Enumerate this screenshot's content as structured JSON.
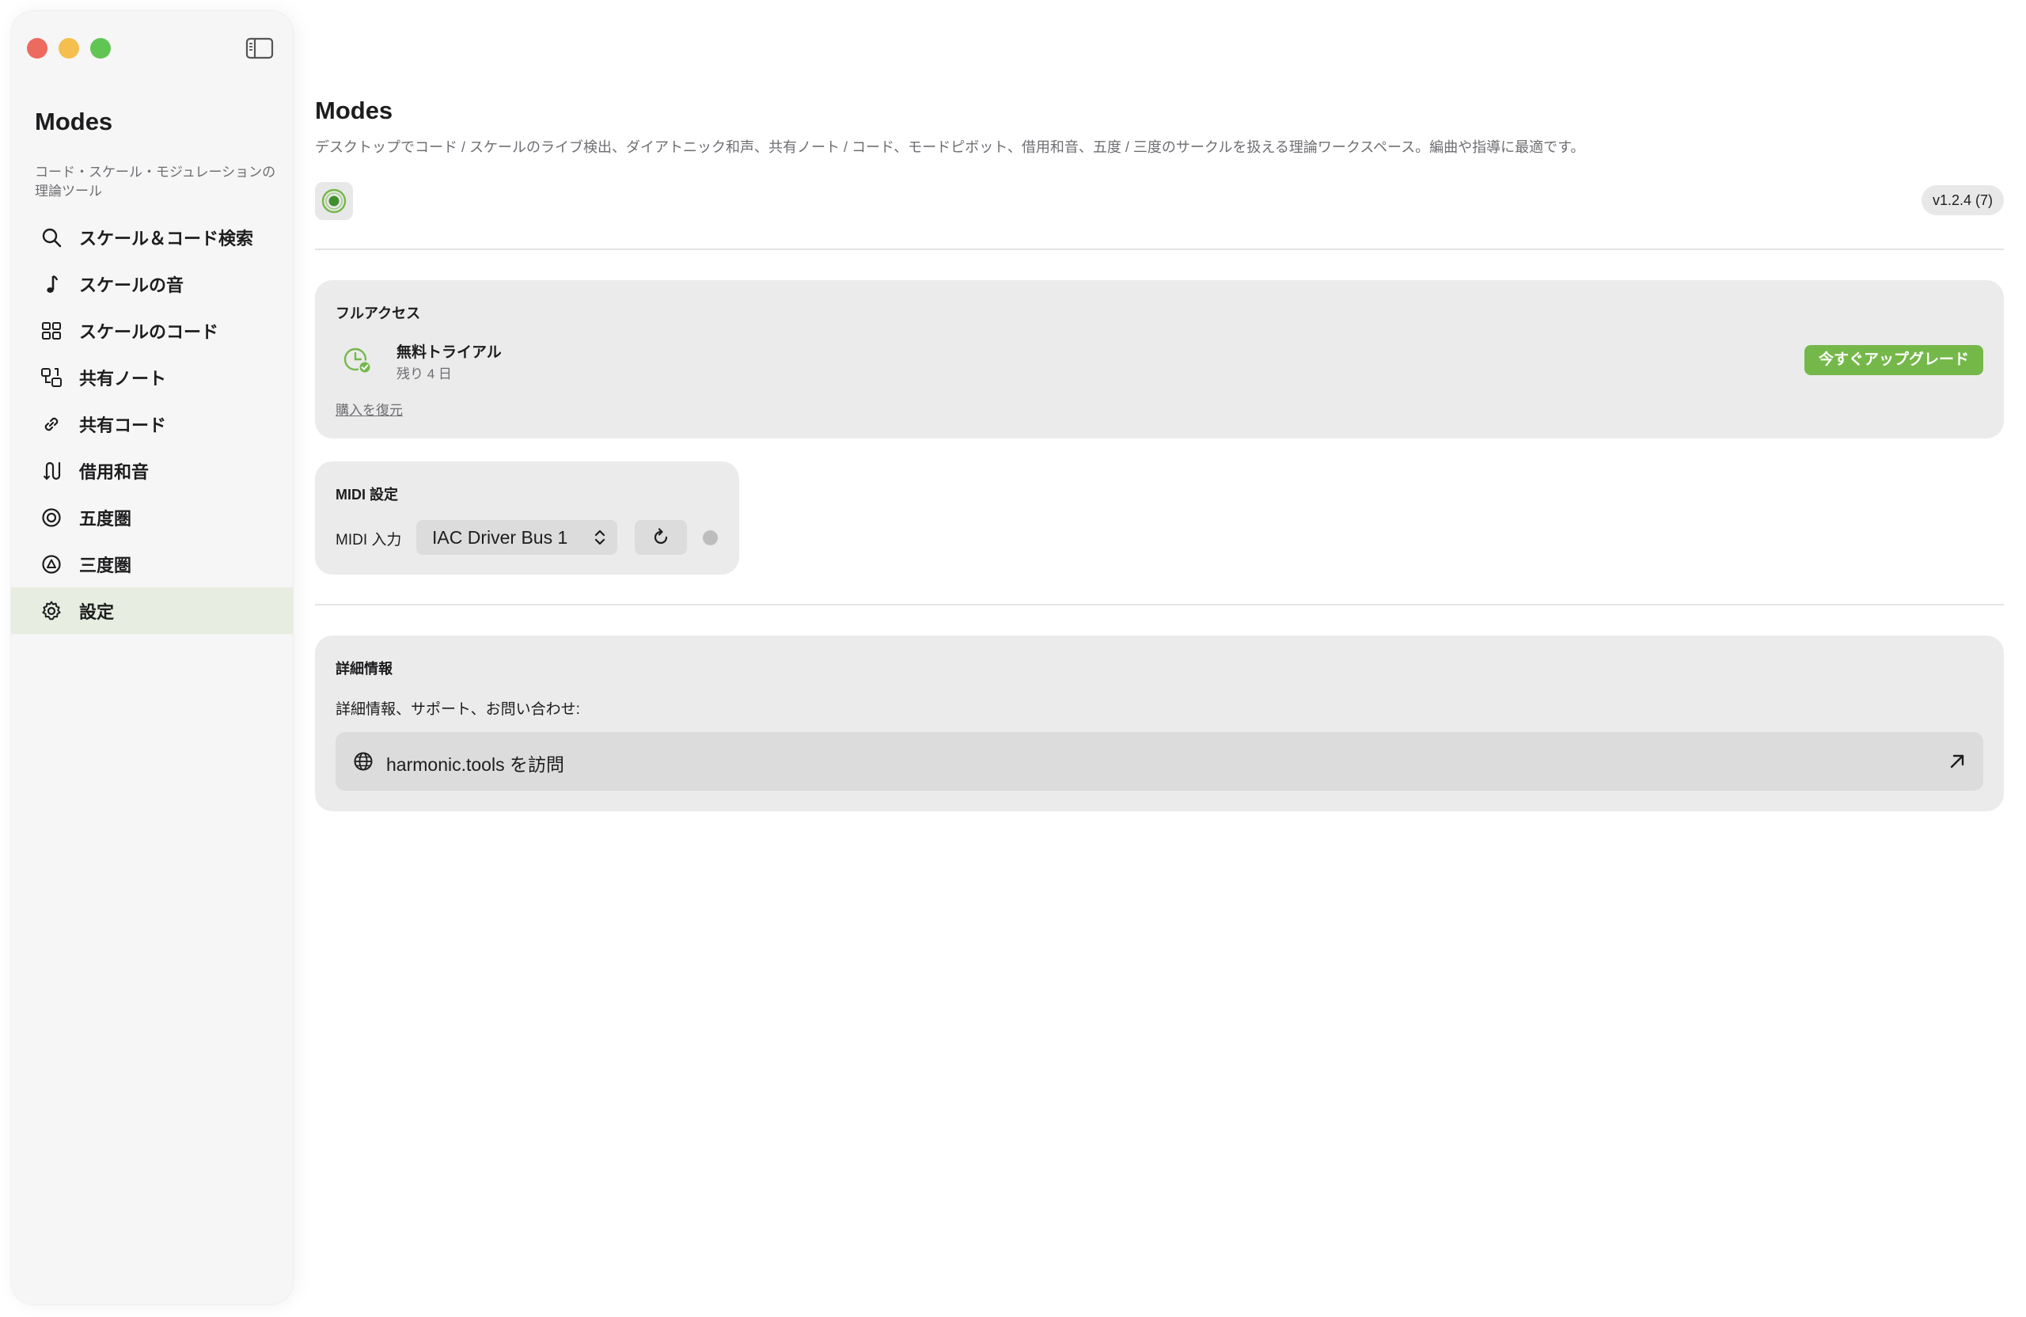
{
  "window": {
    "traffic_lights": [
      "close",
      "minimize",
      "zoom"
    ]
  },
  "sidebar": {
    "toggle_icon": "sidebar-toggle-icon",
    "title": "Modes",
    "subtitle": "コード・スケール・モジュレーションの理論ツール",
    "items": [
      {
        "label": "スケール＆コード検索",
        "icon": "search-icon",
        "active": false
      },
      {
        "label": "スケールの音",
        "icon": "music-note-icon",
        "active": false
      },
      {
        "label": "スケールのコード",
        "icon": "grid-icon",
        "active": false
      },
      {
        "label": "共有ノート",
        "icon": "shared-notes-icon",
        "active": false
      },
      {
        "label": "共有コード",
        "icon": "link-icon",
        "active": false
      },
      {
        "label": "借用和音",
        "icon": "borrowed-chords-icon",
        "active": false
      },
      {
        "label": "五度圏",
        "icon": "circle-of-fifths-icon",
        "active": false
      },
      {
        "label": "三度圏",
        "icon": "circle-of-thirds-icon",
        "active": false
      },
      {
        "label": "設定",
        "icon": "gear-icon",
        "active": true
      }
    ]
  },
  "main": {
    "title": "Modes",
    "description": "デスクトップでコード / スケールのライブ検出、ダイアトニック和声、共有ノート / コード、モードピボット、借用和音、五度 / 三度のサークルを扱える理論ワークスペース。編曲や指導に最適です。",
    "app_icon": "app-logo-icon",
    "version": "v1.2.4 (7)",
    "access": {
      "title": "フルアクセス",
      "plan_name": "無料トライアル",
      "remaining": "残り 4 日",
      "upgrade_label": "今すぐアップグレード",
      "restore_label": "購入を復元"
    },
    "midi": {
      "title": "MIDI 設定",
      "input_label": "MIDI 入力",
      "selected_input": "IAC Driver Bus 1",
      "connected": false
    },
    "details": {
      "title": "詳細情報",
      "text": "詳細情報、サポート、お問い合わせ:",
      "link_label": "harmonic.tools を訪問"
    }
  },
  "colors": {
    "accent": "#75b84a",
    "active_nav_bg": "#e7ede1",
    "card_bg": "#ebebeb",
    "status_dot": "#bdbdbd"
  }
}
